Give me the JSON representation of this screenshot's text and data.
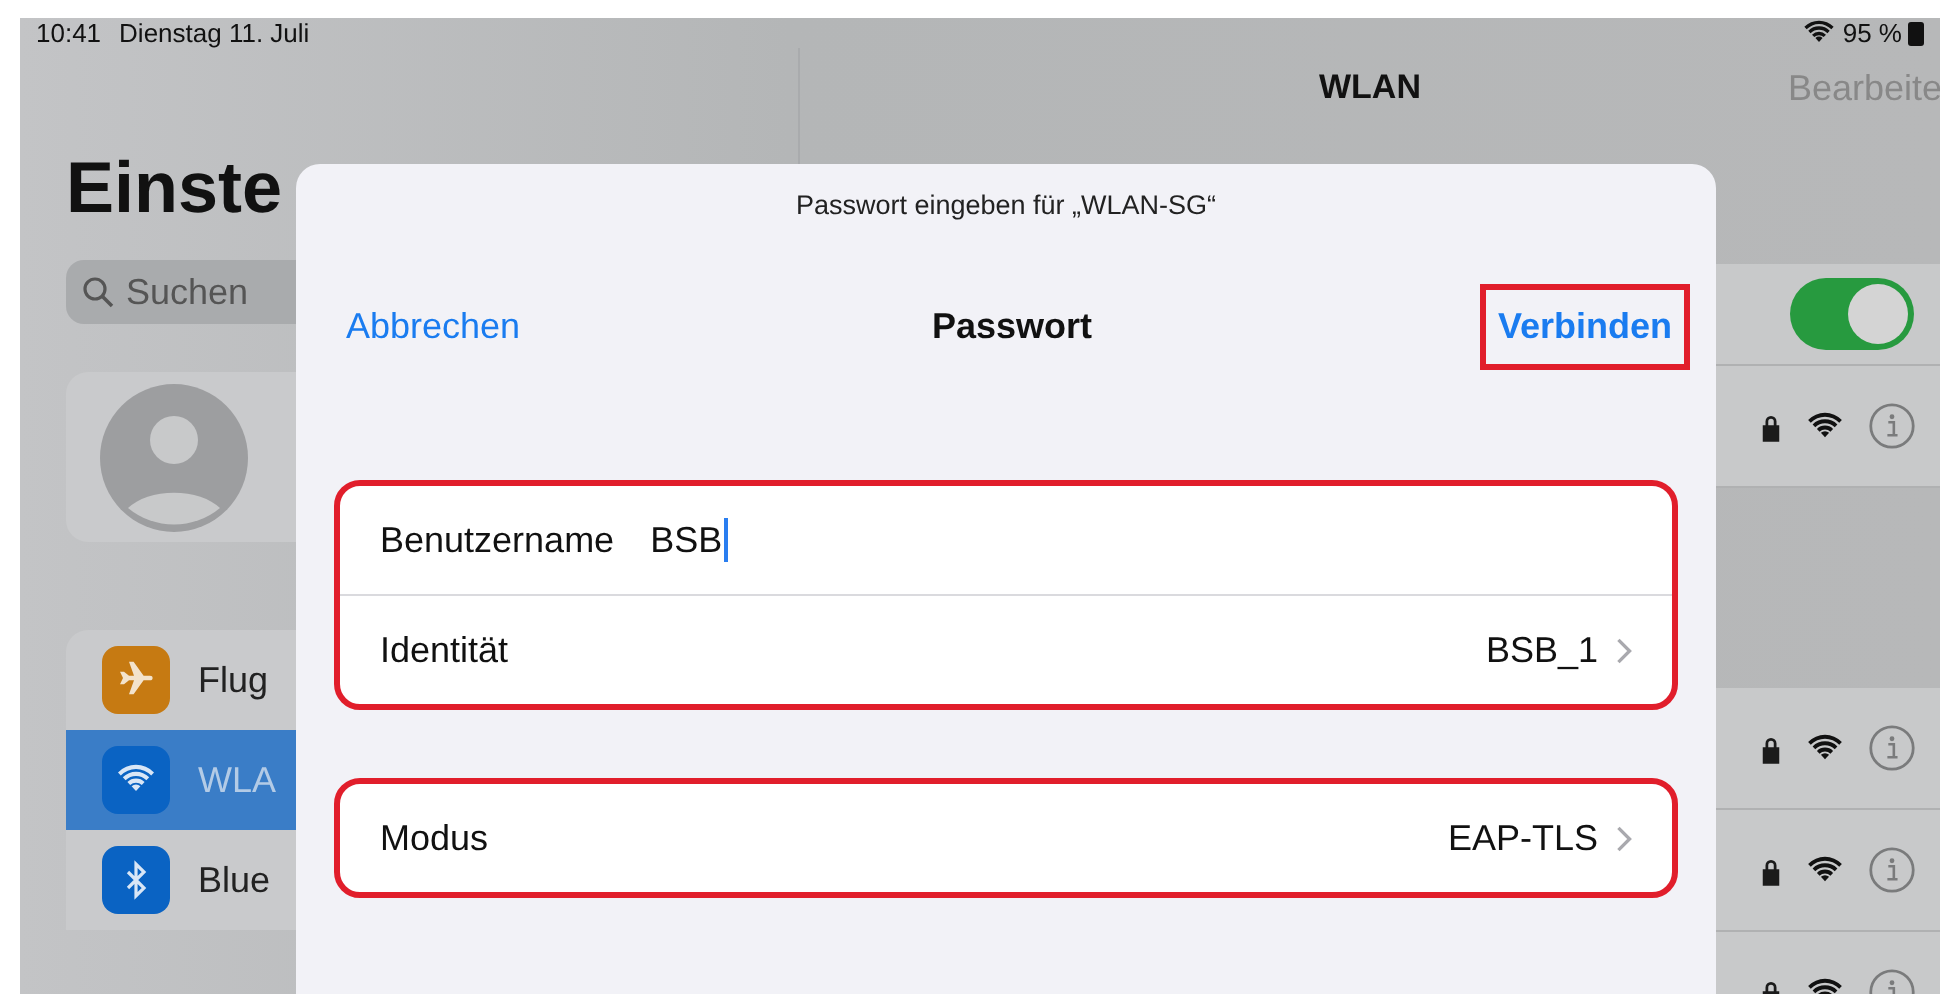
{
  "status_bar": {
    "time": "10:41",
    "date": "Dienstag 11. Juli",
    "battery": "95 %"
  },
  "sidebar": {
    "title": "Einste",
    "search_placeholder": "Suchen",
    "items": [
      {
        "label": "Flug",
        "kind": "airplane",
        "selected": false
      },
      {
        "label": "WLA",
        "kind": "wifi",
        "selected": true
      },
      {
        "label": "Blue",
        "kind": "bluetooth",
        "selected": false
      }
    ]
  },
  "detail": {
    "title": "WLAN",
    "edit": "Bearbeite",
    "wlan_on": true,
    "networks": [
      {
        "secured": true
      },
      {
        "secured": true
      },
      {
        "secured": true
      },
      {
        "secured": true
      }
    ]
  },
  "dialog": {
    "prompt": "Passwort eingeben für „WLAN-SG“",
    "cancel": "Abbrechen",
    "title": "Passwort",
    "confirm": "Verbinden",
    "confirm_highlighted": true,
    "groups": [
      {
        "highlighted": true,
        "rows": [
          {
            "kind": "field",
            "label": "Benutzername",
            "value": "BSB"
          },
          {
            "kind": "disclosure",
            "label": "Identität",
            "value": "BSB_1"
          }
        ]
      },
      {
        "highlighted": true,
        "rows": [
          {
            "kind": "disclosure",
            "label": "Modus",
            "value": "EAP-TLS"
          }
        ]
      }
    ]
  }
}
